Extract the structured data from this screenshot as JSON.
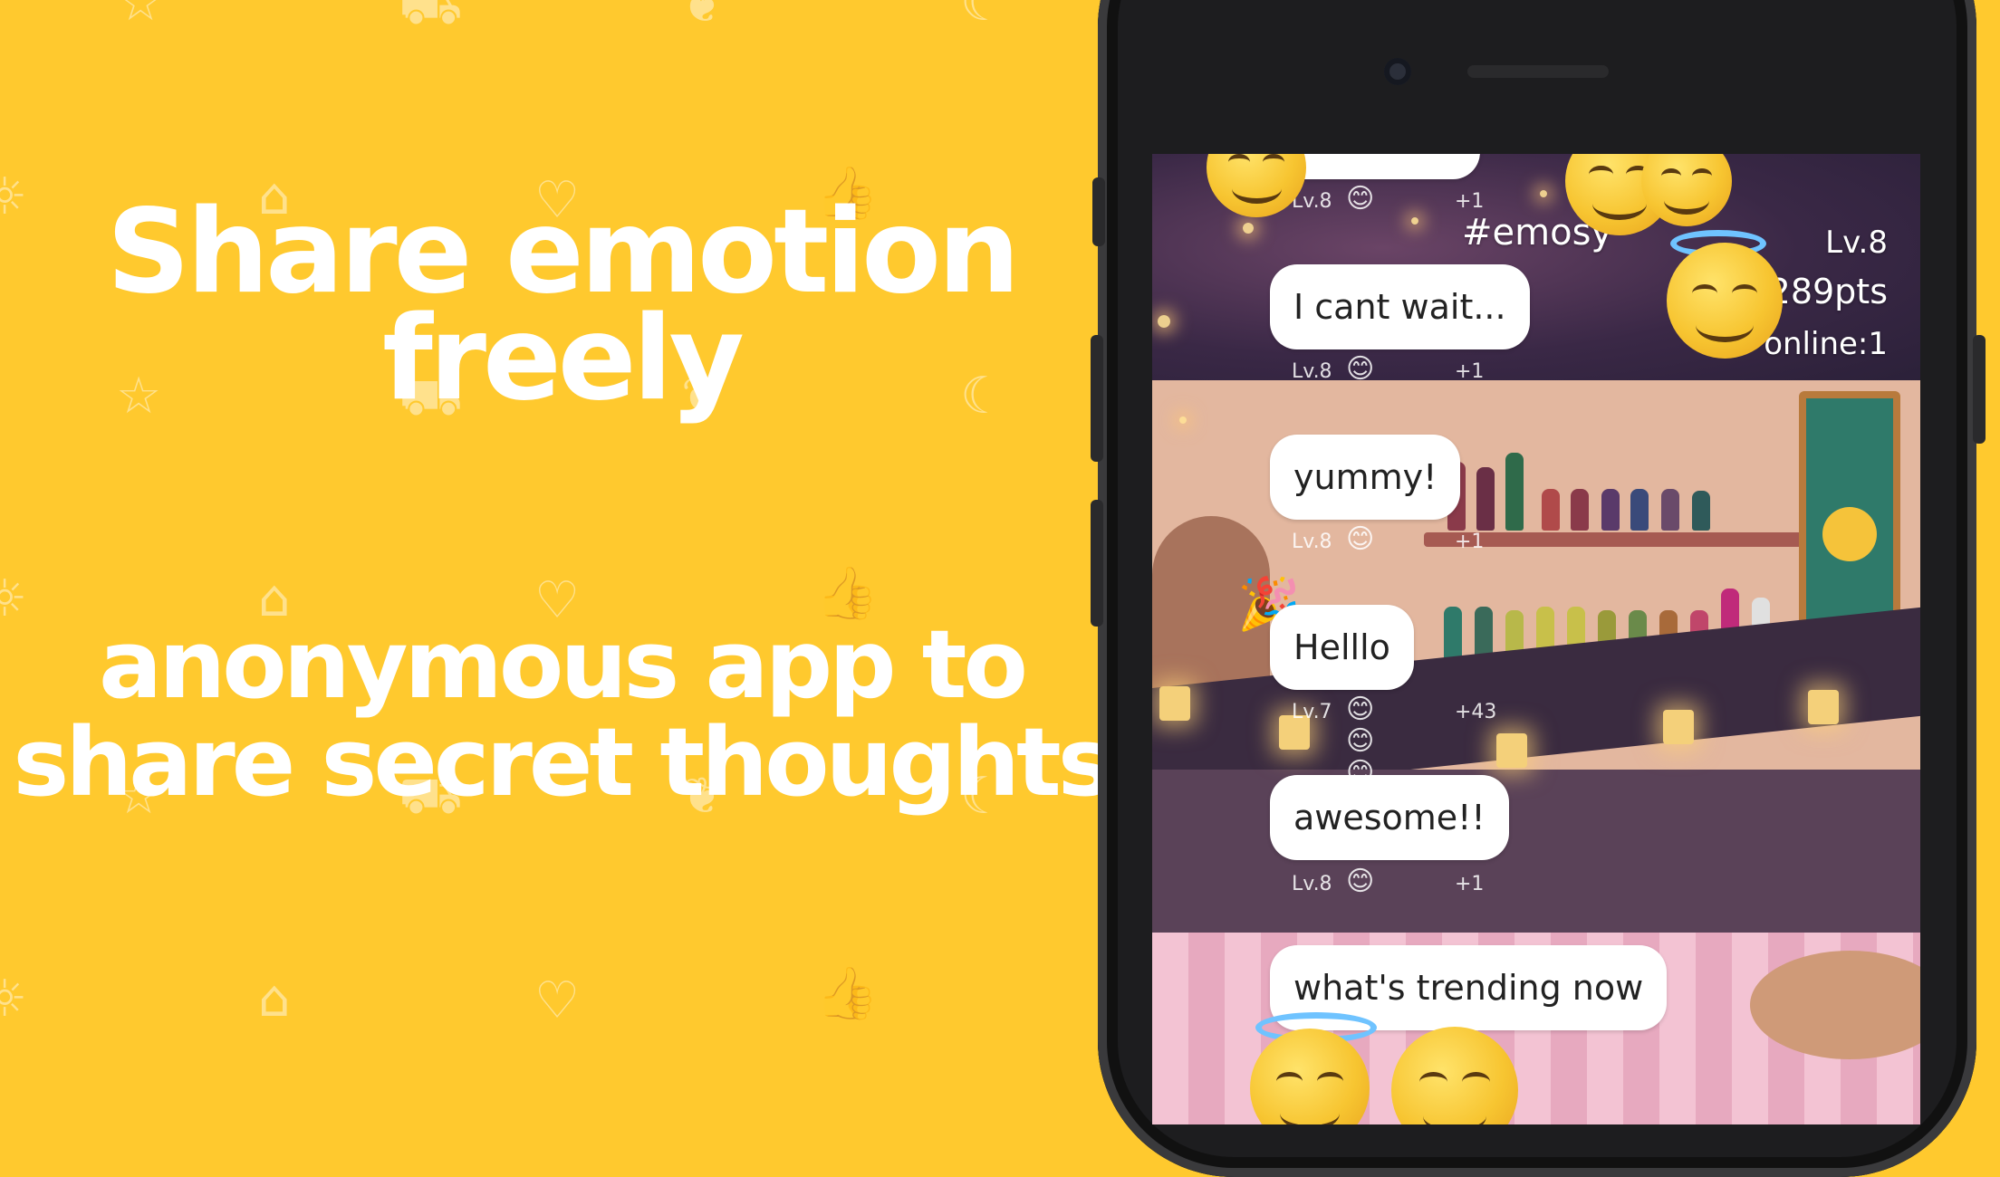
{
  "promo": {
    "headline_line1": "Share emotion",
    "headline_line2": "freely",
    "subline_line1": "anonymous app to",
    "subline_line2": "share secret thoughts"
  },
  "background_color": "#FFC92E",
  "pattern_icons": [
    "star-icon",
    "truck-icon",
    "leaf-icon",
    "moon-icon",
    "sun-icon",
    "bread-icon",
    "heart-icon",
    "thumbs-up-icon"
  ],
  "room": {
    "name": "#emosy",
    "level": "Lv.8",
    "points": "289pts",
    "online": "online:1"
  },
  "messages": [
    {
      "text": "I cant wait...",
      "level": "Lv.8",
      "reactions": "😊",
      "count": "+1"
    },
    {
      "text": "yummy!",
      "level": "Lv.8",
      "reactions": "😊",
      "count": "+1"
    },
    {
      "text": "Helllo",
      "level": "Lv.7",
      "reactions": "😊😊😊",
      "count": "+43"
    },
    {
      "text": "awesome!!",
      "level": "Lv.8",
      "reactions": "😊",
      "count": "+1"
    },
    {
      "text": "what's trending now",
      "level": "",
      "reactions": "",
      "count": ""
    }
  ],
  "top_partial_meta": {
    "level": "Lv.8",
    "reactions": "😊",
    "count": "+1"
  }
}
